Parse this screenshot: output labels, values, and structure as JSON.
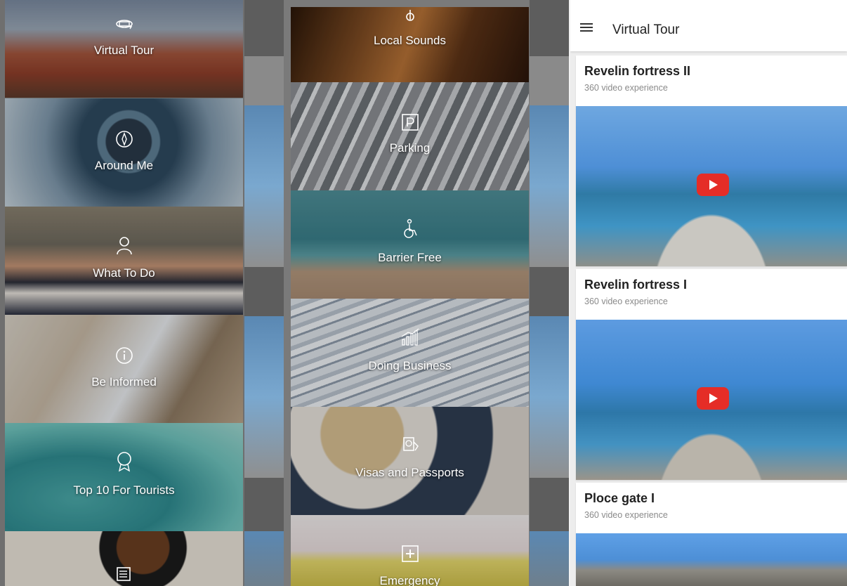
{
  "left_menu": {
    "tiles": [
      {
        "label": "Virtual Tour",
        "icon": "vr-360-icon"
      },
      {
        "label": "Around Me",
        "icon": "compass-icon"
      },
      {
        "label": "What To Do",
        "icon": "person-icon"
      },
      {
        "label": "Be Informed",
        "icon": "info-icon"
      },
      {
        "label": "Top 10 For Tourists",
        "icon": "award-icon"
      },
      {
        "label": "",
        "icon": "news-icon"
      }
    ]
  },
  "middle_menu": {
    "tiles": [
      {
        "label": "Local Sounds",
        "icon": "music-icon"
      },
      {
        "label": "Parking",
        "icon": "parking-icon"
      },
      {
        "label": "Barrier Free",
        "icon": "wheelchair-icon"
      },
      {
        "label": "Doing Business",
        "icon": "chart-icon"
      },
      {
        "label": "Visas and Passports",
        "icon": "passport-icon"
      },
      {
        "label": "Emergency",
        "icon": "first-aid-icon"
      }
    ]
  },
  "virtual_tour": {
    "title": "Virtual Tour",
    "items": [
      {
        "title": "Revelin fortress II",
        "subtitle": "360 video experience"
      },
      {
        "title": "Revelin fortress I",
        "subtitle": "360 video experience"
      },
      {
        "title": "Ploce gate I",
        "subtitle": "360 video experience"
      }
    ]
  },
  "colors": {
    "play_button": "#e52d27",
    "appbar_bg": "#ffffff"
  }
}
